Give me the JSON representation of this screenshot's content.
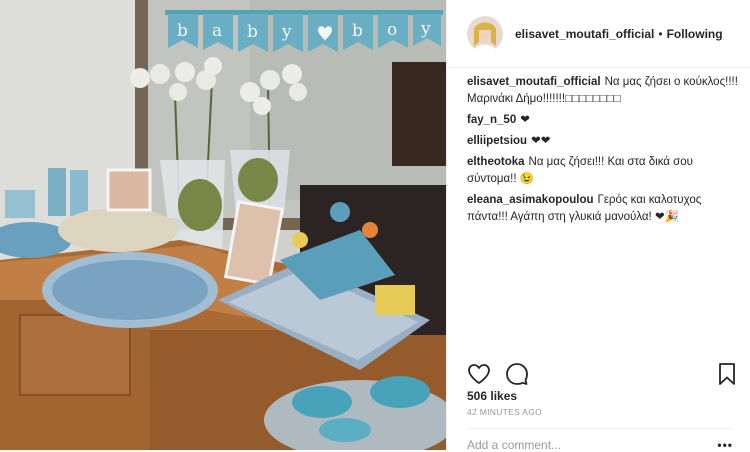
{
  "post": {
    "username": "elisavet_moutafi_official",
    "separator": "•",
    "follow_status": "Following",
    "photo_banner_text": "baby boy",
    "likes": "506 likes",
    "timestamp": "42 MINUTES AGO",
    "add_comment_placeholder": "Add a comment...",
    "more_options": "•••"
  },
  "comments": [
    {
      "user": "elisavet_moutafi_official",
      "text": "Να μας ζήσει ο κούκλος!!!! Μαρινάκι Δήμο!!!!!!!□□□□□□□□"
    },
    {
      "user": "fay_n_50",
      "text": "❤"
    },
    {
      "user": "elliipetsiou",
      "text": "❤❤"
    },
    {
      "user": "eltheotoka",
      "text": "Να μας ζήσει!!! Και στα δικά σου σύντομα!! 😉"
    },
    {
      "user": "eleana_asimakopoulou",
      "text": "Γερός και καλοτυχος πάντα!!! Αγάπη στη γλυκιά μανούλα! ❤🎉"
    }
  ],
  "icons": [
    "heart-icon",
    "comment-icon",
    "bookmark-icon"
  ]
}
